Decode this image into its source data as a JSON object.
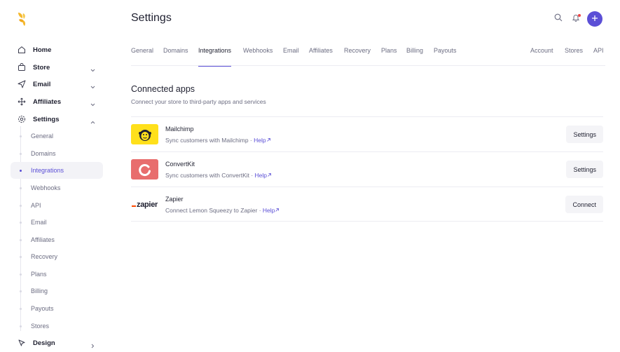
{
  "sidebar": {
    "items": [
      {
        "label": "Home",
        "icon": "home-icon"
      },
      {
        "label": "Store",
        "icon": "shopping-bag-icon"
      },
      {
        "label": "Email",
        "icon": "send-icon"
      },
      {
        "label": "Affiliates",
        "icon": "move-arrows-icon"
      },
      {
        "label": "Settings",
        "icon": "gear-icon"
      }
    ],
    "settings_sub": [
      "General",
      "Domains",
      "Integrations",
      "Webhooks",
      "API",
      "Email",
      "Affiliates",
      "Recovery",
      "Plans",
      "Billing",
      "Payouts",
      "Stores"
    ],
    "active_sub": "Integrations",
    "design": {
      "label": "Design",
      "icon": "cursor-icon"
    }
  },
  "header": {
    "title": "Settings"
  },
  "tabs": {
    "left": [
      "General",
      "Domains",
      "Integrations",
      "Webhooks",
      "Email",
      "Affiliates",
      "Recovery",
      "Plans",
      "Billing",
      "Payouts"
    ],
    "right": [
      "Account",
      "Stores",
      "API"
    ],
    "active": "Integrations"
  },
  "connected": {
    "title": "Connected apps",
    "description": "Connect your store to third-party apps and services",
    "apps": [
      {
        "name": "Mailchimp",
        "desc": "Sync customers with Mailchimp · ",
        "help": "Help",
        "button": "Settings",
        "logo_bg": "#ffe01b"
      },
      {
        "name": "ConvertKit",
        "desc": "Sync customers with ConvertKit · ",
        "help": "Help",
        "button": "Settings",
        "logo_bg": "#e86d6d"
      },
      {
        "name": "Zapier",
        "desc": "Connect Lemon Squeezy to Zapier · ",
        "help": "Help",
        "button": "Connect",
        "logo_text": "zapier"
      }
    ]
  },
  "colors": {
    "accent": "#5b4fd6",
    "notification": "#ef4444",
    "logo": "#f5b82e"
  }
}
